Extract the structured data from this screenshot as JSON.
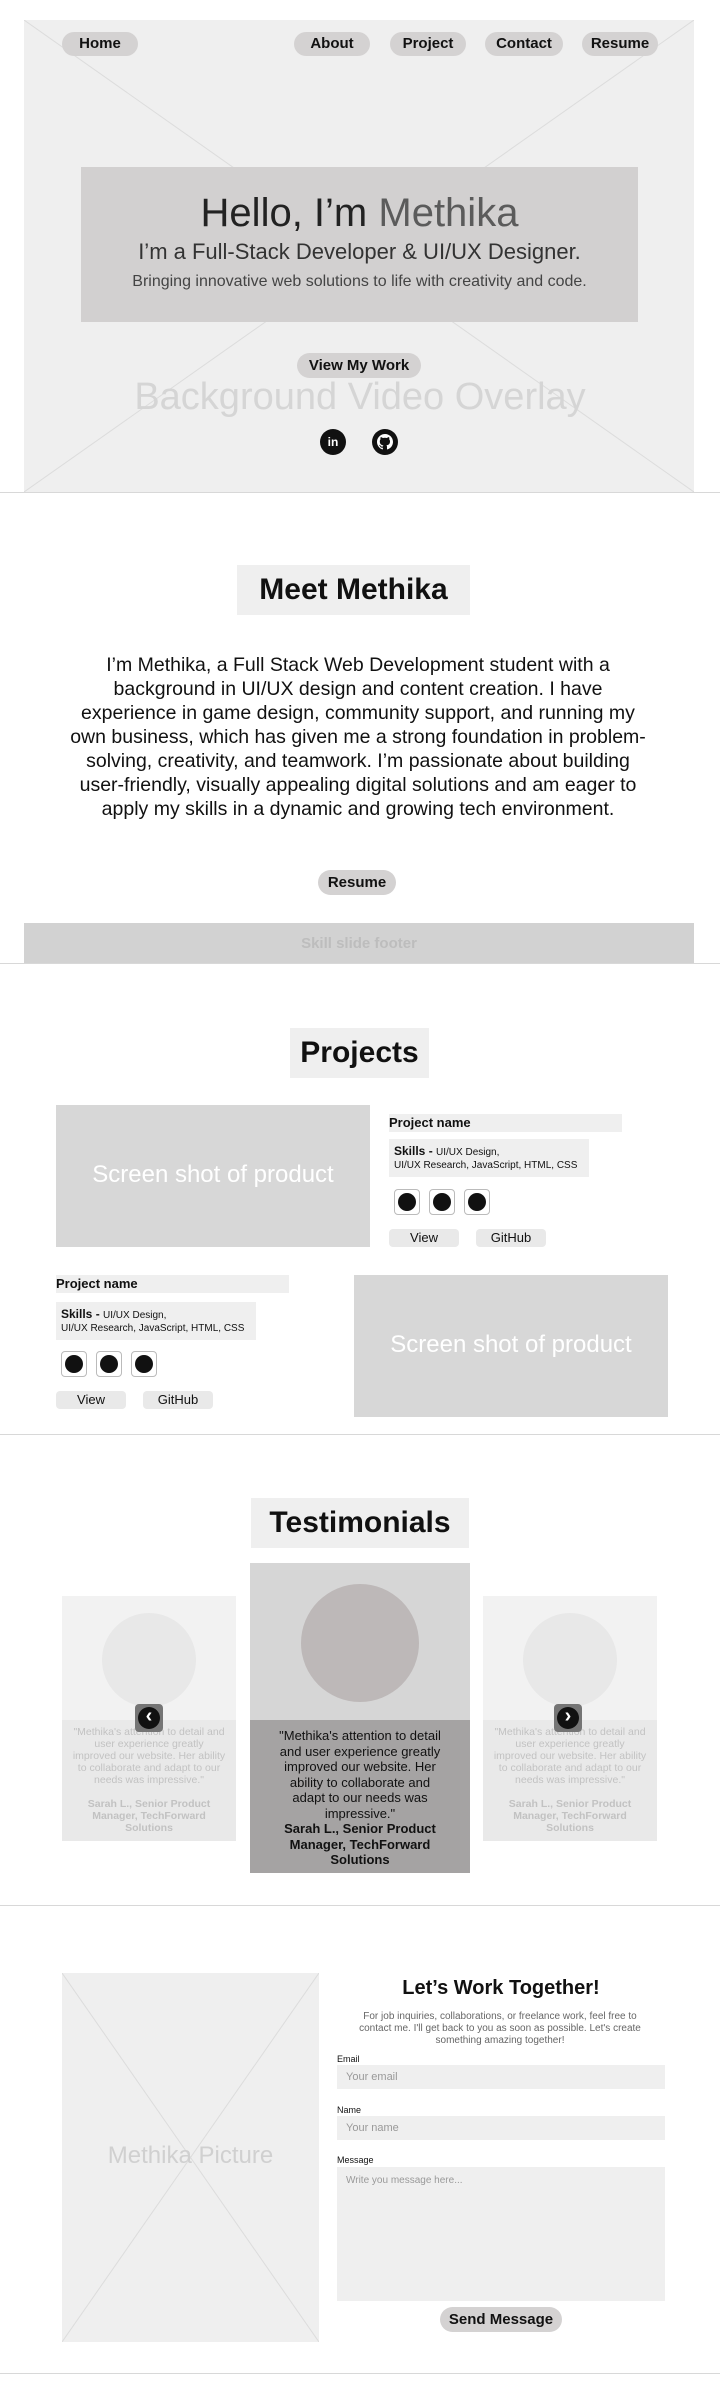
{
  "nav": {
    "home": "Home",
    "about": "About",
    "project": "Project",
    "contact": "Contact",
    "resume": "Resume"
  },
  "hero": {
    "greeting": "Hello, I’m",
    "name": "Methika",
    "subtitle": "I’m a Full-Stack Developer & UI/UX Designer.",
    "tagline": "Bringing innovative web solutions to life with creativity and code.",
    "cta": "View My Work",
    "overlay_text": "Background Video Overlay",
    "social": [
      {
        "icon": "linkedin-icon",
        "glyph": "in"
      },
      {
        "icon": "github-icon",
        "glyph": ""
      }
    ]
  },
  "about": {
    "title": "Meet Methika",
    "body": "I’m Methika, a Full Stack Web Development student with a background in UI/UX design and content creation. I have experience in game design, community support, and running my own business, which has given me a strong foundation in problem-solving, creativity, and teamwork. I’m passionate about building user-friendly, visually appealing digital solutions and am eager to apply my skills in a dynamic and growing tech environment.",
    "resume_button": "Resume",
    "footer_text": "Skill slide footer"
  },
  "projects": {
    "title": "Projects",
    "items": [
      {
        "screenshot": "Screen shot of product",
        "name": "Project name",
        "skills_label": "Skills - ",
        "skills_line1": "UI/UX Design,",
        "skills_line2": "UI/UX Research, JavaScript, HTML, CSS",
        "view": "View",
        "github": "GitHub"
      },
      {
        "screenshot": "Screen shot of product",
        "name": "Project name",
        "skills_label": "Skills - ",
        "skills_line1": "UI/UX Design,",
        "skills_line2": "UI/UX Research, JavaScript, HTML, CSS",
        "view": "View",
        "github": "GitHub"
      }
    ]
  },
  "testimonials": {
    "title": "Testimonials",
    "quote": "\"Methika's attention to detail and user experience greatly improved our website. Her ability to collaborate and adapt to our needs was impressive.\"",
    "author": "Sarah L., Senior Product Manager, TechForward Solutions",
    "prev_glyph": "‹",
    "next_glyph": "›"
  },
  "contact": {
    "picture_text": "Methika Picture",
    "title": "Let’s Work Together!",
    "intro": "For job inquiries, collaborations, or freelance work, feel free to contact me. I'll get back to you as soon as possible. Let's create something amazing together!",
    "email_label": "Email",
    "email_placeholder": "Your email",
    "name_label": "Name",
    "name_placeholder": "Your name",
    "message_label": "Message",
    "message_placeholder": "Write you message here...",
    "send": "Send Message"
  }
}
